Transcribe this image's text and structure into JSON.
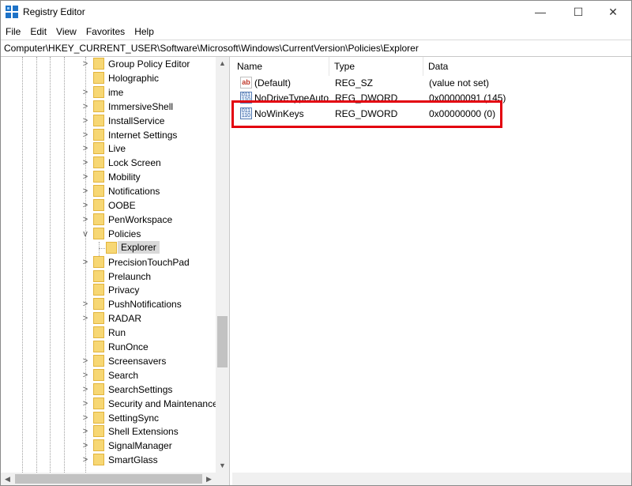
{
  "window": {
    "title": "Registry Editor",
    "minimize_glyph": "—",
    "maximize_glyph": "☐",
    "close_glyph": "✕"
  },
  "menu": [
    "File",
    "Edit",
    "View",
    "Favorites",
    "Help"
  ],
  "address": "Computer\\HKEY_CURRENT_USER\\Software\\Microsoft\\Windows\\CurrentVersion\\Policies\\Explorer",
  "tree": {
    "items": [
      {
        "label": "Group Policy Editor",
        "expander": ">"
      },
      {
        "label": "Holographic",
        "expander": ""
      },
      {
        "label": "ime",
        "expander": ">"
      },
      {
        "label": "ImmersiveShell",
        "expander": ">"
      },
      {
        "label": "InstallService",
        "expander": ">"
      },
      {
        "label": "Internet Settings",
        "expander": ">"
      },
      {
        "label": "Live",
        "expander": ">"
      },
      {
        "label": "Lock Screen",
        "expander": ">"
      },
      {
        "label": "Mobility",
        "expander": ">"
      },
      {
        "label": "Notifications",
        "expander": ">"
      },
      {
        "label": "OOBE",
        "expander": ">"
      },
      {
        "label": "PenWorkspace",
        "expander": ">"
      },
      {
        "label": "Policies",
        "expander": "v"
      },
      {
        "label": "Explorer",
        "expander": "",
        "selected": true
      },
      {
        "label": "PrecisionTouchPad",
        "expander": ">"
      },
      {
        "label": "Prelaunch",
        "expander": ""
      },
      {
        "label": "Privacy",
        "expander": ""
      },
      {
        "label": "PushNotifications",
        "expander": ">"
      },
      {
        "label": "RADAR",
        "expander": ">"
      },
      {
        "label": "Run",
        "expander": ""
      },
      {
        "label": "RunOnce",
        "expander": ""
      },
      {
        "label": "Screensavers",
        "expander": ">"
      },
      {
        "label": "Search",
        "expander": ">"
      },
      {
        "label": "SearchSettings",
        "expander": ">"
      },
      {
        "label": "Security and Maintenance",
        "expander": ">"
      },
      {
        "label": "SettingSync",
        "expander": ">"
      },
      {
        "label": "Shell Extensions",
        "expander": ">"
      },
      {
        "label": "SignalManager",
        "expander": ">"
      },
      {
        "label": "SmartGlass",
        "expander": ">"
      }
    ]
  },
  "list": {
    "columns": [
      "Name",
      "Type",
      "Data"
    ],
    "rows": [
      {
        "icon": "string-value-icon",
        "icon_text": "ab",
        "name": "(Default)",
        "type": "REG_SZ",
        "data": "(value not set)"
      },
      {
        "icon": "dword-value-icon",
        "icon_text": "011 110",
        "name": "NoDriveTypeAutoRun",
        "type": "REG_DWORD",
        "data": "0x00000091 (145)"
      },
      {
        "icon": "dword-value-icon",
        "icon_text": "011 110",
        "name": "NoWinKeys",
        "type": "REG_DWORD",
        "data": "0x00000000 (0)"
      }
    ]
  },
  "colors": {
    "highlight_border": "#e3000f",
    "selection_bg": "#d9d9d9",
    "folder_fill": "#f7d774"
  }
}
